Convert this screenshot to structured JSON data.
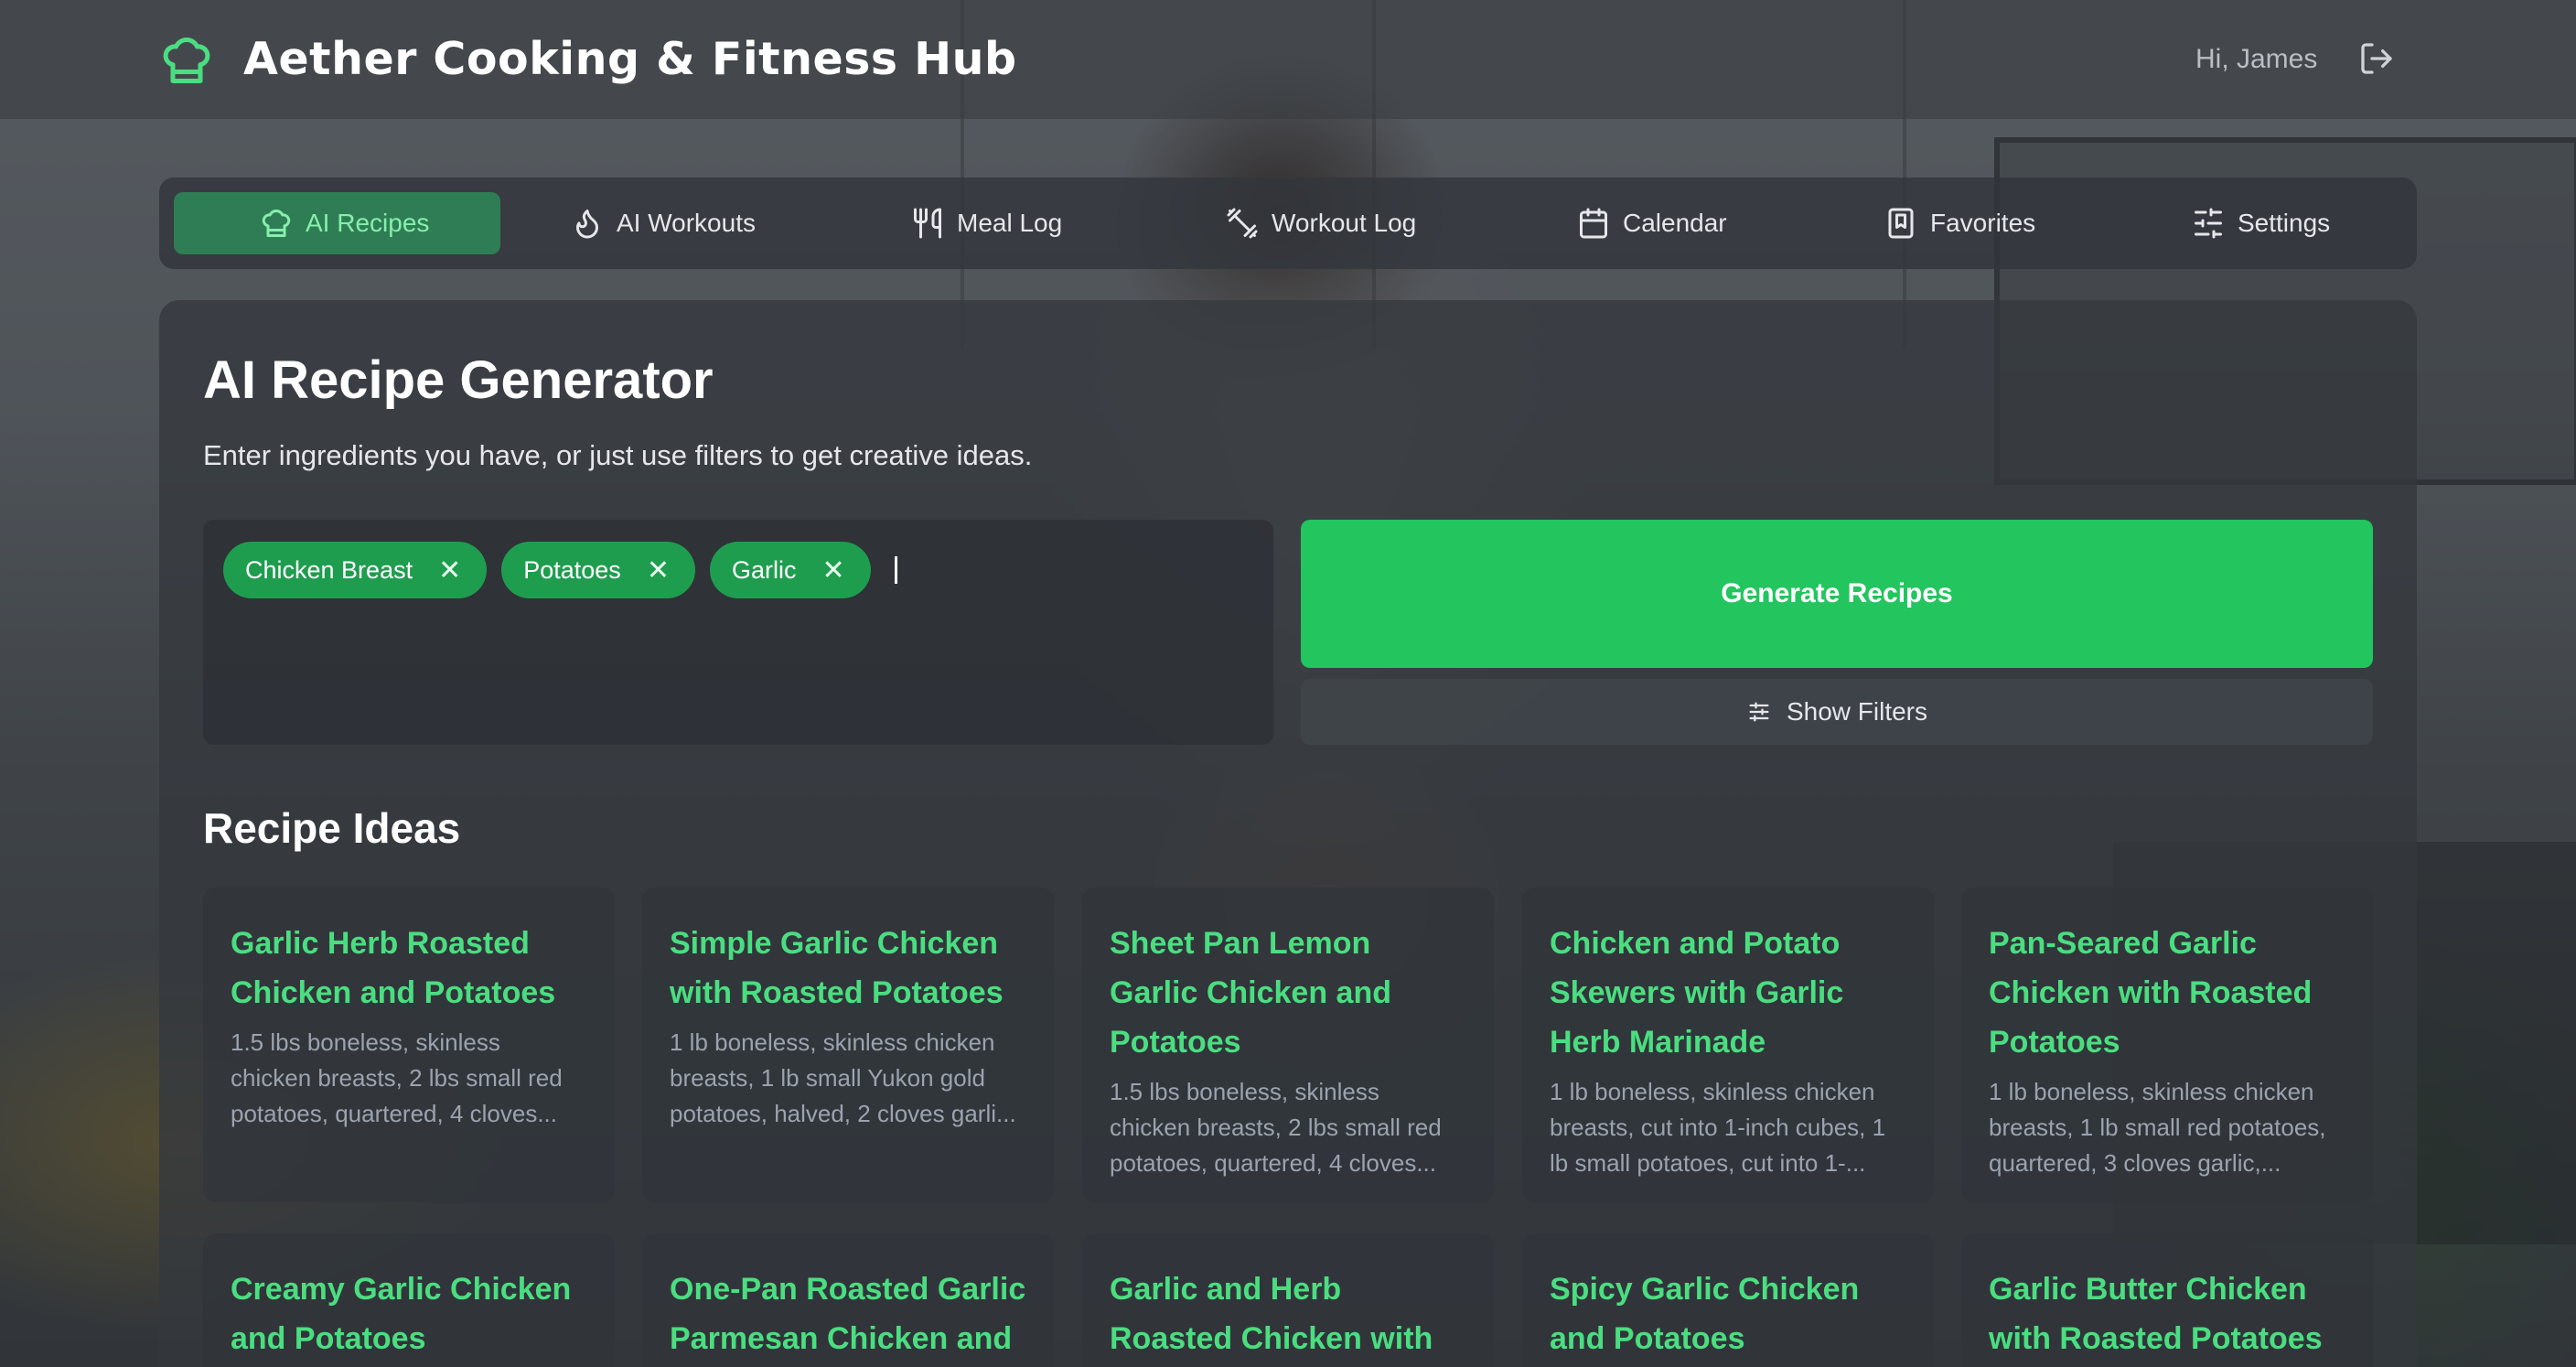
{
  "app": {
    "title": "Aether Cooking & Fitness Hub",
    "greeting": "Hi, James",
    "accent": "#22c55e"
  },
  "nav": {
    "items": [
      {
        "label": "AI Recipes",
        "icon": "chef-hat-icon",
        "active": true
      },
      {
        "label": "AI Workouts",
        "icon": "flame-icon"
      },
      {
        "label": "Meal Log",
        "icon": "utensils-icon"
      },
      {
        "label": "Workout Log",
        "icon": "dumbbell-icon"
      },
      {
        "label": "Calendar",
        "icon": "calendar-icon"
      },
      {
        "label": "Favorites",
        "icon": "bookmark-icon"
      },
      {
        "label": "Settings",
        "icon": "sliders-icon"
      }
    ]
  },
  "generator": {
    "title": "AI Recipe Generator",
    "subtitle": "Enter ingredients you have, or just use filters to get creative ideas.",
    "ingredients": [
      "Chicken Breast",
      "Potatoes",
      "Garlic"
    ],
    "remove_glyph": "✕",
    "generate_label": "Generate Recipes",
    "filters_label": "Show Filters"
  },
  "recipes": {
    "title": "Recipe Ideas",
    "items": [
      {
        "title": "Garlic Herb Roasted Chicken and Potatoes",
        "desc": "1.5 lbs boneless, skinless chicken breasts, 2 lbs small red potatoes, quartered, 4 cloves..."
      },
      {
        "title": "Simple Garlic Chicken with Roasted Potatoes",
        "desc": "1 lb boneless, skinless chicken breasts, 1 lb small Yukon gold potatoes, halved, 2 cloves garli..."
      },
      {
        "title": "Sheet Pan Lemon Garlic Chicken and Potatoes",
        "desc": "1.5 lbs boneless, skinless chicken breasts, 2 lbs small red potatoes, quartered, 4 cloves..."
      },
      {
        "title": "Chicken and Potato Skewers with Garlic Herb Marinade",
        "desc": "1 lb boneless, skinless chicken breasts, cut into 1-inch cubes, 1 lb small potatoes, cut into 1-..."
      },
      {
        "title": "Pan-Seared Garlic Chicken with Roasted Potatoes",
        "desc": "1 lb boneless, skinless chicken breasts, 1 lb small red potatoes, quartered, 3 cloves garlic,..."
      },
      {
        "title": "Creamy Garlic Chicken and Potatoes",
        "desc": ""
      },
      {
        "title": "One-Pan Roasted Garlic Parmesan Chicken and",
        "desc": ""
      },
      {
        "title": "Garlic and Herb Roasted Chicken with",
        "desc": ""
      },
      {
        "title": "Spicy Garlic Chicken and Potatoes",
        "desc": ""
      },
      {
        "title": "Garlic Butter Chicken with Roasted Potatoes",
        "desc": ""
      }
    ]
  }
}
